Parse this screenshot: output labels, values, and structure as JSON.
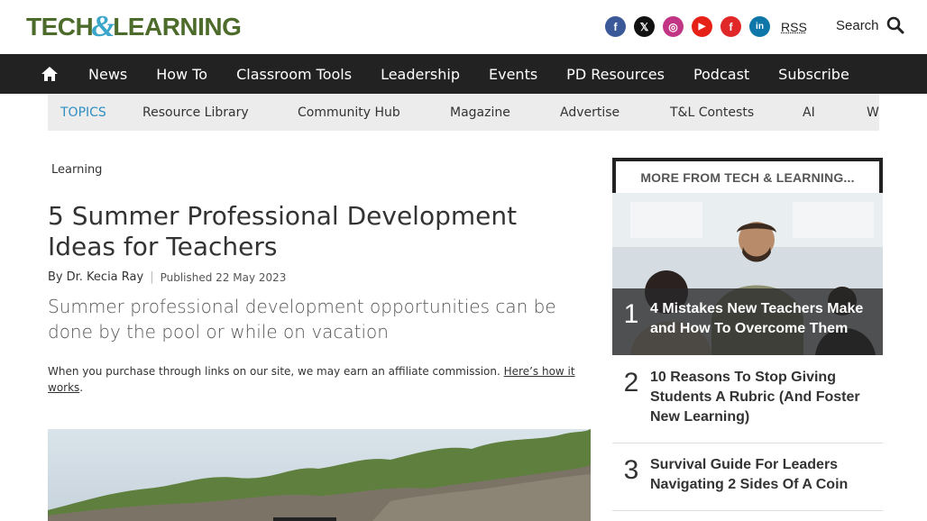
{
  "header": {
    "logo_text_1": "TECH",
    "logo_amp": "&",
    "logo_text_2": "LEARNING",
    "social": [
      {
        "name": "facebook-icon",
        "glyph": "f",
        "color": "#3b5998"
      },
      {
        "name": "x-twitter-icon",
        "glyph": "𝕏",
        "color": "#111111"
      },
      {
        "name": "instagram-icon",
        "glyph": "◎",
        "color": "#c13584"
      },
      {
        "name": "youtube-icon",
        "glyph": "▶",
        "color": "#e62117"
      },
      {
        "name": "flipboard-icon",
        "glyph": "f",
        "color": "#e12828"
      },
      {
        "name": "linkedin-icon",
        "glyph": "in",
        "color": "#0e76a8"
      }
    ],
    "rss_label": "RSS",
    "search_label": "Search"
  },
  "nav": {
    "items": [
      "News",
      "How To",
      "Classroom Tools",
      "Leadership",
      "Events",
      "PD Resources",
      "Podcast",
      "Subscribe"
    ]
  },
  "topics": {
    "label": "TOPICS",
    "items": [
      "Resource Library",
      "Community Hub",
      "Magazine",
      "Advertise",
      "T&L Contests",
      "AI",
      "W"
    ]
  },
  "article": {
    "breadcrumb": "Learning",
    "title": "5 Summer Professional Development Ideas for Teachers",
    "byline_prefix": "By",
    "author": "Dr. Kecia Ray",
    "published": "Published 22 May 2023",
    "subtitle": "Summer professional development opportunities can be done by the pool or while on vacation",
    "affiliate_text": "When you purchase through links on our site, we may earn an affiliate commission.",
    "affiliate_link": "Here’s how it works",
    "affiliate_end": "."
  },
  "sidebar": {
    "heading": "MORE FROM TECH & LEARNING...",
    "items": [
      {
        "num": "1",
        "title": "4 Mistakes New Teachers Make and How To Overcome Them"
      },
      {
        "num": "2",
        "title": "10 Reasons To Stop Giving Students A Rubric (And Foster New Learning)"
      },
      {
        "num": "3",
        "title": "Survival Guide For Leaders Navigating 2 Sides Of A Coin"
      }
    ]
  }
}
